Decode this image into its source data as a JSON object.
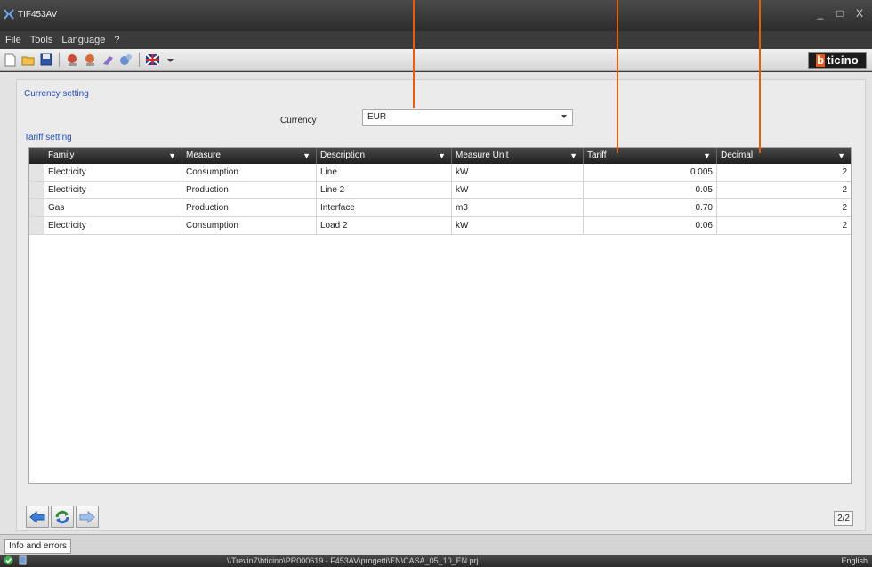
{
  "window": {
    "title": "TIF453AV",
    "minimize": "_",
    "maximize": "□",
    "close": "X"
  },
  "menu": [
    "File",
    "Tools",
    "Language",
    "?"
  ],
  "brand": {
    "b": "b",
    "text": "ticino"
  },
  "currency_section": {
    "label": "Currency setting",
    "field_label": "Currency",
    "selected": "EUR"
  },
  "tariff_section": {
    "label": "Tariff setting"
  },
  "grid": {
    "columns": [
      "Family",
      "Measure",
      "Description",
      "Measure Unit",
      "Tariff",
      "Decimal"
    ],
    "rows": [
      [
        "Electricity",
        "Consumption",
        "Line",
        "kW",
        "0.005",
        "2"
      ],
      [
        "Electricity",
        "Production",
        "Line 2",
        "kW",
        "0.05",
        "2"
      ],
      [
        "Gas",
        "Production",
        "Interface",
        "m3",
        "0.70",
        "2"
      ],
      [
        "Electricity",
        "Consumption",
        "Load 2",
        "kW",
        "0.06",
        "2"
      ]
    ]
  },
  "pager": "2/2",
  "info_tab": "Info and errors",
  "status": {
    "path": "\\\\Trevin7\\bticino\\PR000619 - F453AV\\progetti\\EN\\CASA_05_10_EN.prj",
    "language": "English"
  },
  "colors": {
    "accent": "#2550b8",
    "callout": "#e35e14",
    "brand": "#e85a0f"
  }
}
